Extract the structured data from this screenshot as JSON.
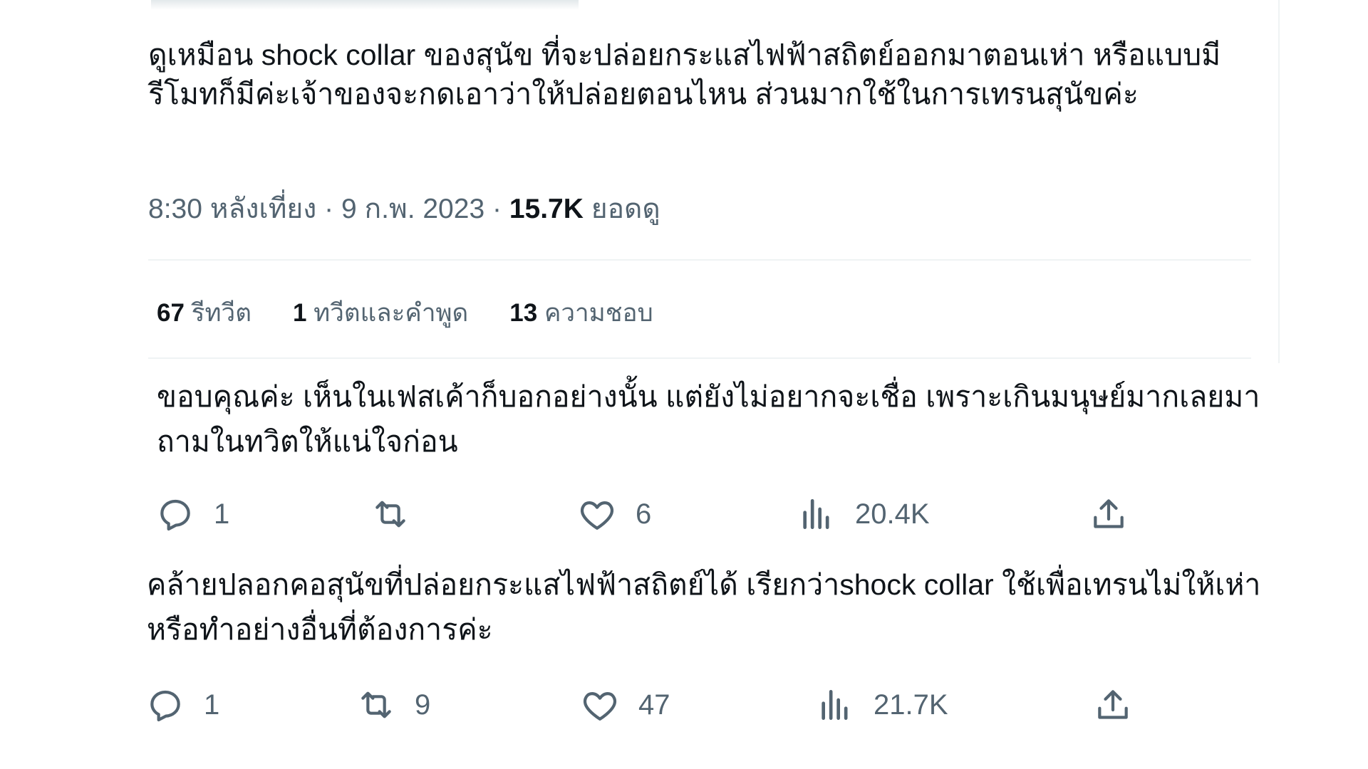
{
  "main_tweet": {
    "text": "ดูเหมือน shock collar ของสุนัข ที่จะปล่อยกระแสไฟฟ้าสถิตย์ออกมาตอนเห่า หรือแบบมีรีโมทก็มีค่ะเจ้าของจะกดเอาว่าให้ปล่อยตอนไหน ส่วนมากใช้ในการเทรนสุนัขค่ะ",
    "time": "8:30 หลังเที่ยง",
    "separator": "·",
    "date": "9 ก.พ. 2023",
    "views_count": "15.7K",
    "views_label": "ยอดดู"
  },
  "stats": {
    "retweets_count": "67",
    "retweets_label": "รีทวีต",
    "quotes_count": "1",
    "quotes_label": "ทวีตและคำพูด",
    "likes_count": "13",
    "likes_label": "ความชอบ"
  },
  "replies": [
    {
      "text": "ขอบคุณค่ะ เห็นในเฟสเค้าก็บอกอย่างนั้น แต่ยังไม่อยากจะเชื่อ เพราะเกินมนุษย์มากเลยมาถามในทวิตให้แน่ใจก่อน",
      "reply_count": "1",
      "retweet_count": "",
      "like_count": "6",
      "view_count": "20.4K"
    },
    {
      "text": "คล้ายปลอกคอสุนัขที่ปล่อยกระแสไฟฟ้าสถิตย์ได้ เรียกว่าshock collar ใช้เพื่อเทรนไม่ให้เห่า หรือทำอย่างอื่นที่ต้องการค่ะ",
      "reply_count": "1",
      "retweet_count": "9",
      "like_count": "47",
      "view_count": "21.7K"
    }
  ],
  "icons": {
    "reply": "comment-bubble-icon",
    "retweet": "retweet-icon",
    "like": "heart-icon",
    "views": "bar-chart-icon",
    "share": "share-upload-icon"
  },
  "colors": {
    "text_primary": "#0f1419",
    "text_secondary": "#536471",
    "divider": "#eff3f4"
  }
}
